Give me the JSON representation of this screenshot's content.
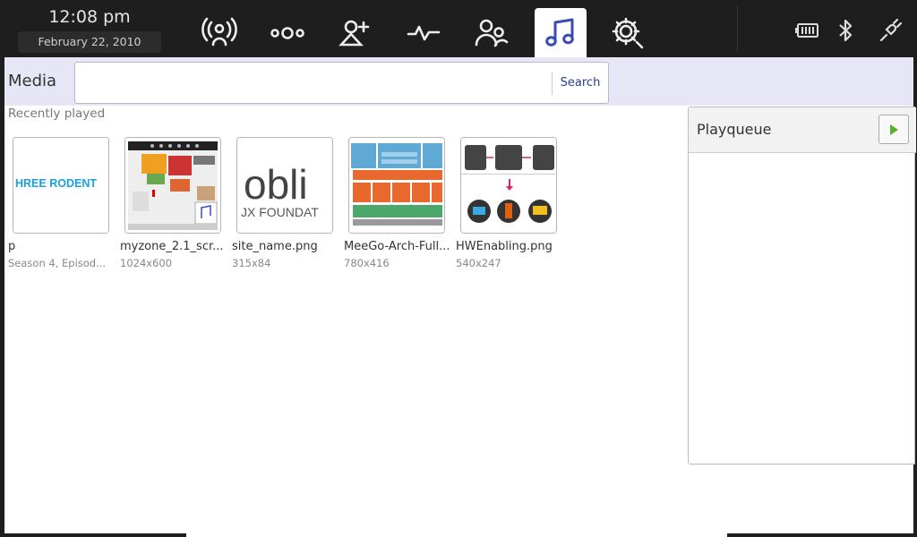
{
  "clock": {
    "time": "12:08 pm",
    "date": "February 22, 2010"
  },
  "nav": [
    {
      "id": "status",
      "icon": "broadcast-person-icon"
    },
    {
      "id": "zones",
      "icon": "dots-circles-icon"
    },
    {
      "id": "people",
      "icon": "add-person-icon"
    },
    {
      "id": "applications",
      "icon": "pulse-icon"
    },
    {
      "id": "contacts",
      "icon": "people-icon"
    },
    {
      "id": "media",
      "icon": "music-note-icon",
      "active": true
    },
    {
      "id": "settings",
      "icon": "gear-icon"
    }
  ],
  "status_icons": [
    "battery-icon",
    "bluetooth-icon",
    "network-plug-icon"
  ],
  "media": {
    "title": "Media",
    "search": {
      "value": "",
      "button_label": "Search"
    },
    "section_label": "Recently played",
    "items": [
      {
        "title": "p",
        "subtitle": "Season 4, Episod...",
        "thumb_text": "HREE RODENT"
      },
      {
        "title": "myzone_2.1_scr...",
        "subtitle": "1024x600"
      },
      {
        "title": "site_name.png",
        "subtitle": "315x84",
        "thumb_text_main": "obli",
        "thumb_text_sub": "JX FOUNDAT"
      },
      {
        "title": "MeeGo-Arch-Full...",
        "subtitle": "780x416"
      },
      {
        "title": "HWEnabling.png",
        "subtitle": "540x247"
      }
    ]
  },
  "playqueue": {
    "title": "Playqueue"
  },
  "colors": {
    "accent": "#3b4bb5",
    "header_band": "#e6e6f7",
    "topbar": "#1e1e1e",
    "play_green": "#5ab026"
  }
}
